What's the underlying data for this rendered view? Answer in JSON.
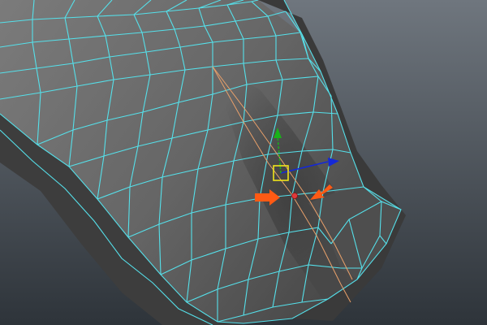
{
  "viewport": {
    "background_top": "#6f767e",
    "background_bottom": "#2e343a"
  },
  "mesh": {
    "wire_color": "#55e0ea",
    "shade_light": "#7b7b7b",
    "shade_mid": "#626262",
    "shade_dark": "#3b3b3b",
    "edge_highlight_color": "#e9a06a"
  },
  "manipulator": {
    "x_axis_color": "#1428d8",
    "y_axis_color": "#19b219",
    "center_color": "#f1e51a",
    "pivot_color": "#e03a3a"
  },
  "annotations": {
    "arrow_color": "#ff5a14",
    "arrow_icon": "slide-edge-arrows"
  }
}
